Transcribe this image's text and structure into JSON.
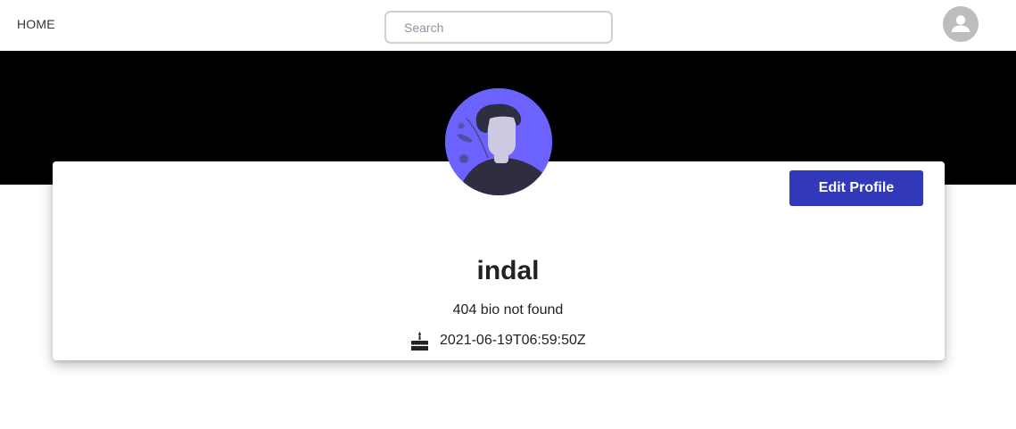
{
  "nav": {
    "home_label": "HOME",
    "search_placeholder": "Search",
    "avatar_icon": "account-icon"
  },
  "profile": {
    "avatar_icon": "person-illustration",
    "edit_label": "Edit Profile",
    "username": "indal",
    "bio": "404 bio not found",
    "joined_icon": "cake-icon",
    "joined_date": "2021-06-19T06:59:50Z"
  },
  "colors": {
    "banner": "#000000",
    "accent_button": "#3238ba",
    "avatar_bg": "#6c63ff",
    "nav_avatar_bg": "#bdbdbd"
  }
}
